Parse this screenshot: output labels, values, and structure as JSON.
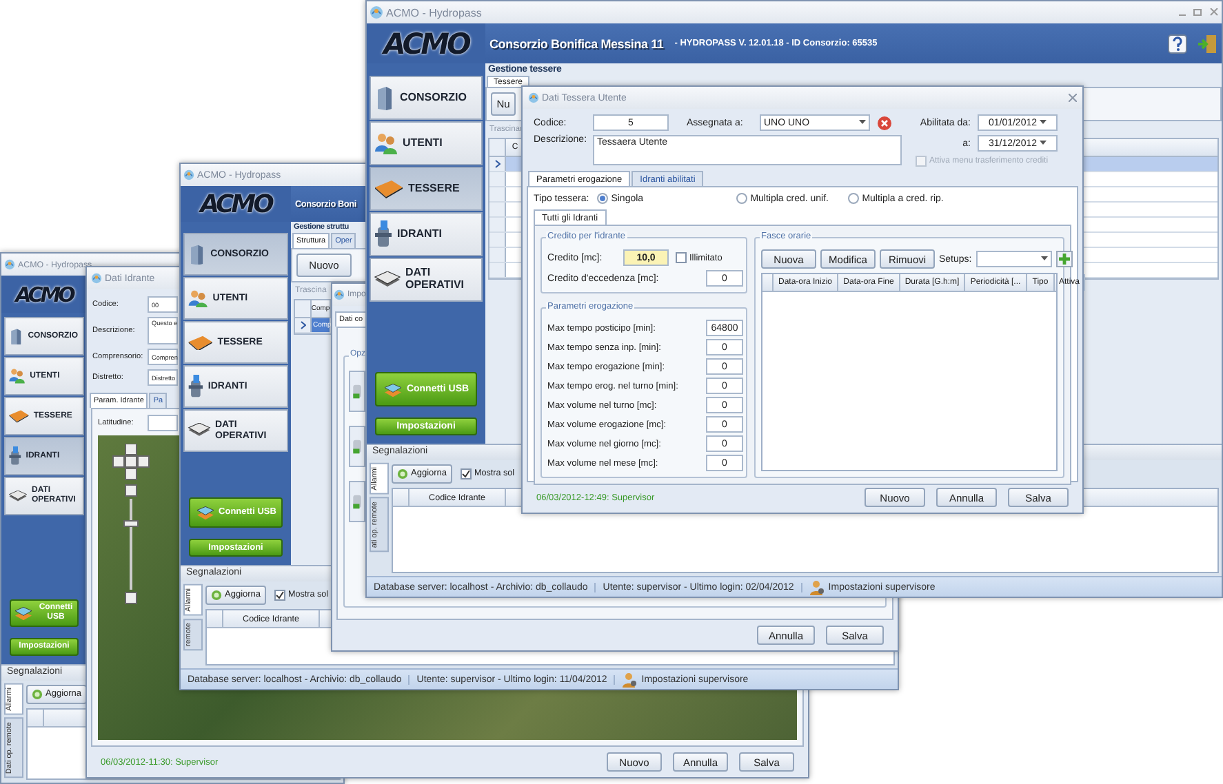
{
  "back_window": {
    "title": "ACMO - Hydropass",
    "logo": "ACMO",
    "sidebar": {
      "items": [
        {
          "label": "CONSORZIO",
          "kind": "building",
          "selected": false
        },
        {
          "label": "UTENTI",
          "kind": "users",
          "selected": false
        },
        {
          "label": "TESSERE",
          "kind": "card",
          "selected": false
        },
        {
          "label": "IDRANTI",
          "kind": "hydrant",
          "selected": true
        },
        {
          "label": "DATI OPERATIVI",
          "kind": "stack",
          "selected": false
        }
      ],
      "usb_button": "Connetti USB",
      "settings_button": "Impostazioni"
    },
    "signals": {
      "title": "Segnalazioni",
      "refresh_button": "Aggiorna",
      "tabs": [
        {
          "label": "Allarmi",
          "selected": true
        },
        {
          "label": "Dati op. remote",
          "selected": false
        }
      ]
    },
    "dialog": {
      "title": "Dati Idrante",
      "fields": [
        {
          "label": "Codice:",
          "value": "00"
        },
        {
          "label": "Descrizione:",
          "value": "Questo e"
        },
        {
          "label": "Comprensorio:",
          "value": "Compren"
        },
        {
          "label": "Distretto:",
          "value": "Distretto"
        }
      ],
      "tabs": [
        {
          "label": "Param. Idrante",
          "selected": true
        },
        {
          "label": "Pa",
          "selected": false
        }
      ],
      "latitude_label": "Latitudine:",
      "stamp": "06/03/2012-11:30: Supervisor",
      "buttons": [
        "Nuovo",
        "Annulla",
        "Salva"
      ]
    }
  },
  "middle_window": {
    "title": "ACMO - Hydropass",
    "logo": "ACMO",
    "header_title": "Consorzio Boni",
    "sidebar": {
      "items": [
        {
          "label": "CONSORZIO",
          "kind": "building",
          "selected": true
        },
        {
          "label": "UTENTI",
          "kind": "users",
          "selected": false
        },
        {
          "label": "TESSERE",
          "kind": "card",
          "selected": false
        },
        {
          "label": "IDRANTI",
          "kind": "hydrant",
          "selected": false
        },
        {
          "label": "DATI OPERATIVI",
          "kind": "stack",
          "selected": false
        }
      ],
      "usb_button": "Connetti USB",
      "settings_button": "Impostazioni"
    },
    "section": "Gestione struttu",
    "tabs": [
      {
        "label": "Struttura",
        "selected": true
      },
      {
        "label": "Oper",
        "selected": false
      }
    ],
    "new_button": "Nuovo",
    "drag_hint": "Trascina",
    "grid": {
      "columns": [
        "Comp"
      ],
      "rows": [
        {
          "cells": [
            "Comp"
          ],
          "selected": true
        }
      ]
    },
    "signals": {
      "title": "Segnalazioni",
      "refresh_button": "Aggiorna",
      "show_only": {
        "label": "Mostra sol",
        "checked": true
      },
      "column": "Codice Idrante",
      "tabs": [
        {
          "label": "Allarmi",
          "selected": true
        },
        {
          "label": "remote",
          "selected": false
        }
      ]
    },
    "status_bar": [
      "Database server: localhost - Archivio: db_collaudo",
      "Utente: supervisor - Ultimo login: 11/04/2012",
      "Impostazioni supervisore"
    ],
    "dialog": {
      "title": "Impo",
      "tabs": [
        {
          "label": "Dati co",
          "selected": true
        }
      ],
      "group": "Opz",
      "buttons": [
        "Annulla",
        "Salva"
      ]
    }
  },
  "front_window": {
    "title": "ACMO - Hydropass",
    "logo": "ACMO",
    "header_title": "Consorzio Bonifica Messina 11",
    "header_subtitle": "- HYDROPASS V. 12.01.18 - ID Consorzio: 65535",
    "sidebar": {
      "items": [
        {
          "label": "CONSORZIO",
          "kind": "building",
          "selected": false
        },
        {
          "label": "UTENTI",
          "kind": "users",
          "selected": false
        },
        {
          "label": "TESSERE",
          "kind": "card",
          "selected": true
        },
        {
          "label": "IDRANTI",
          "kind": "hydrant",
          "selected": false
        },
        {
          "label": "DATI OPERATIVI",
          "kind": "stack",
          "selected": false
        }
      ],
      "usb_button": "Connetti USB",
      "settings_button": "Impostazioni"
    },
    "section": "Gestione tessere",
    "tabs": [
      {
        "label": "Tessere",
        "selected": true
      }
    ],
    "new_button": "Nu",
    "drag_hint": "Trascinar",
    "grid": {
      "columns": [
        "C"
      ],
      "rows": [
        {
          "selected": true
        },
        {
          "selected": false
        },
        {
          "selected": false
        },
        {
          "selected": false
        },
        {
          "selected": false
        },
        {
          "selected": false
        },
        {
          "selected": false
        },
        {
          "selected": false
        }
      ]
    },
    "signals": {
      "title": "Segnalazioni",
      "refresh_button": "Aggiorna",
      "show_only": {
        "label": "Mostra sol",
        "checked": true
      },
      "column": "Codice Idrante",
      "tabs": [
        {
          "label": "Allarmi",
          "selected": true
        },
        {
          "label": "ati op. remote",
          "selected": false
        }
      ]
    },
    "status_bar": [
      "Database server: localhost - Archivio: db_collaudo",
      "Utente: supervisor - Ultimo login: 02/04/2012",
      "Impostazioni supervisore"
    ],
    "dialog": {
      "title": "Dati Tessera Utente",
      "code": {
        "label": "Codice:",
        "value": "5"
      },
      "assigned": {
        "label": "Assegnata a:",
        "value": "UNO UNO"
      },
      "from": {
        "label": "Abilitata da:",
        "value": "01/01/2012"
      },
      "to": {
        "label": "a:",
        "value": "31/12/2012"
      },
      "description": {
        "label": "Descrizione:",
        "value": "Tessaera Utente"
      },
      "transfer": {
        "label": "Attiva menu trasferimento crediti",
        "checked": false,
        "disabled": true
      },
      "tabs": [
        {
          "label": "Parametri erogazione",
          "selected": true
        },
        {
          "label": "Idranti abilitati",
          "selected": false
        }
      ],
      "card_type": {
        "label": "Tipo tessera:",
        "options": [
          {
            "label": "Singola",
            "selected": true
          },
          {
            "label": "Multipla cred. unif.",
            "selected": false
          },
          {
            "label": "Multipla a cred. rip.",
            "selected": false
          }
        ]
      },
      "inner_tab": "Tutti gli Idranti",
      "credit_group": {
        "title": "Credito per l'idrante",
        "credit": {
          "label": "Credito [mc]:",
          "value": "10,0"
        },
        "unlimited": {
          "label": "Illimitato",
          "checked": false
        },
        "excess": {
          "label": "Credito d'eccedenza [mc]:",
          "value": "0"
        }
      },
      "params_group": {
        "title": "Parametri erogazione",
        "rows": [
          {
            "label": "Max tempo posticipo [min]:",
            "value": "64800"
          },
          {
            "label": "Max tempo senza inp. [min]:",
            "value": "0"
          },
          {
            "label": "Max tempo erogazione [min]:",
            "value": "0"
          },
          {
            "label": "Max tempo erog. nel turno [min]:",
            "value": "0"
          },
          {
            "label": "Max volume nel turno [mc]:",
            "value": "0"
          },
          {
            "label": "Max volume erogazione [mc]:",
            "value": "0"
          },
          {
            "label": "Max volume nel giorno [mc]:",
            "value": "0"
          },
          {
            "label": "Max volume nel mese [mc]:",
            "value": "0"
          }
        ]
      },
      "slots_group": {
        "title": "Fasce orarie",
        "buttons": [
          "Nuova",
          "Modifica",
          "Rimuovi"
        ],
        "setups_label": "Setups:",
        "columns": [
          "Data-ora Inizio",
          "Data-ora Fine",
          "Durata [G.h:m]",
          "Periodicità [...",
          "Tipo",
          "Attiva"
        ]
      },
      "stamp": "06/03/2012-12:49: Supervisor",
      "buttons": [
        "Nuovo",
        "Annulla",
        "Salva"
      ]
    }
  }
}
